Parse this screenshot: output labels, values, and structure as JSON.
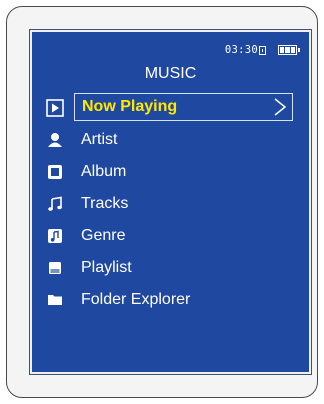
{
  "status": {
    "time": "03:30",
    "lock_icon": "lock-icon",
    "battery_icon": "battery-full-icon"
  },
  "screen": {
    "title": "MUSIC",
    "menu": [
      {
        "label": "Now Playing",
        "icon": "play-icon",
        "selected": true
      },
      {
        "label": "Artist",
        "icon": "person-icon"
      },
      {
        "label": "Album",
        "icon": "album-icon"
      },
      {
        "label": "Tracks",
        "icon": "music-note-icon"
      },
      {
        "label": "Genre",
        "icon": "genre-icon"
      },
      {
        "label": "Playlist",
        "icon": "playlist-icon"
      },
      {
        "label": "Folder Explorer",
        "icon": "folder-icon"
      }
    ]
  },
  "colors": {
    "screen_bg": "#1f48a0",
    "highlight_text": "#ffe800",
    "text": "#ffffff"
  }
}
